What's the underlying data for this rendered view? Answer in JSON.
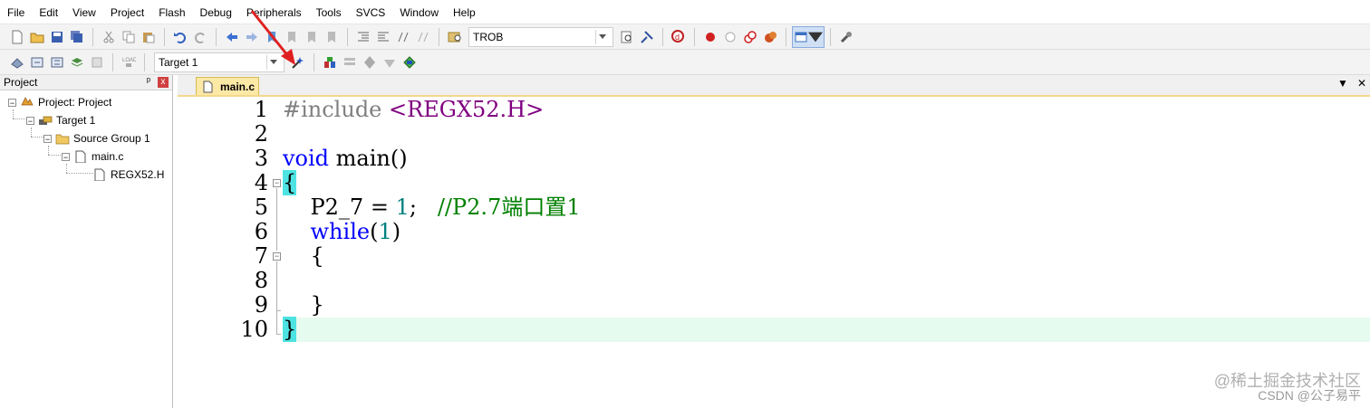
{
  "menu": [
    "File",
    "Edit",
    "View",
    "Project",
    "Flash",
    "Debug",
    "Peripherals",
    "Tools",
    "SVCS",
    "Window",
    "Help"
  ],
  "toolbar1": {
    "target_combo_value": "TROB"
  },
  "toolbar2": {
    "target_select_value": "Target 1"
  },
  "project_panel": {
    "title": "Project",
    "pin": "ᵖ",
    "close": "x",
    "tree": {
      "root": "Project: Project",
      "target": "Target 1",
      "group": "Source Group 1",
      "file": "main.c",
      "header": "REGX52.H"
    }
  },
  "editor": {
    "tab": "main.c",
    "tab_menu": "▼",
    "tab_close": "✕",
    "line_numbers": [
      "1",
      "2",
      "3",
      "4",
      "5",
      "6",
      "7",
      "8",
      "9",
      "10"
    ],
    "code": {
      "l1_pp": "#include",
      "l1_hdr": " <REGX52.H>",
      "l3_kw": "void",
      "l3_rest": " main()",
      "l4": "{",
      "l5_a": "    P2_7 = ",
      "l5_num": "1",
      "l5_b": ";   ",
      "l5_cm": "//P2.7端口置1",
      "l6_kw": "    while",
      "l6_a": "(",
      "l6_num": "1",
      "l6_b": ")",
      "l7": "    {",
      "l9": "    }",
      "l10": "}"
    }
  },
  "watermark": {
    "line1": "@稀土掘金技术社区",
    "line2": "CSDN @公子易平"
  },
  "colors": {
    "keyword": "#0000ff",
    "preprocessor": "#808080",
    "header": "#800080",
    "number": "#008080",
    "comment": "#008000",
    "line_highlight": "#e6fbef",
    "brace_match": "#4de3e3",
    "tab_active": "#fde9a6",
    "annotation_arrow": "#e02020"
  }
}
